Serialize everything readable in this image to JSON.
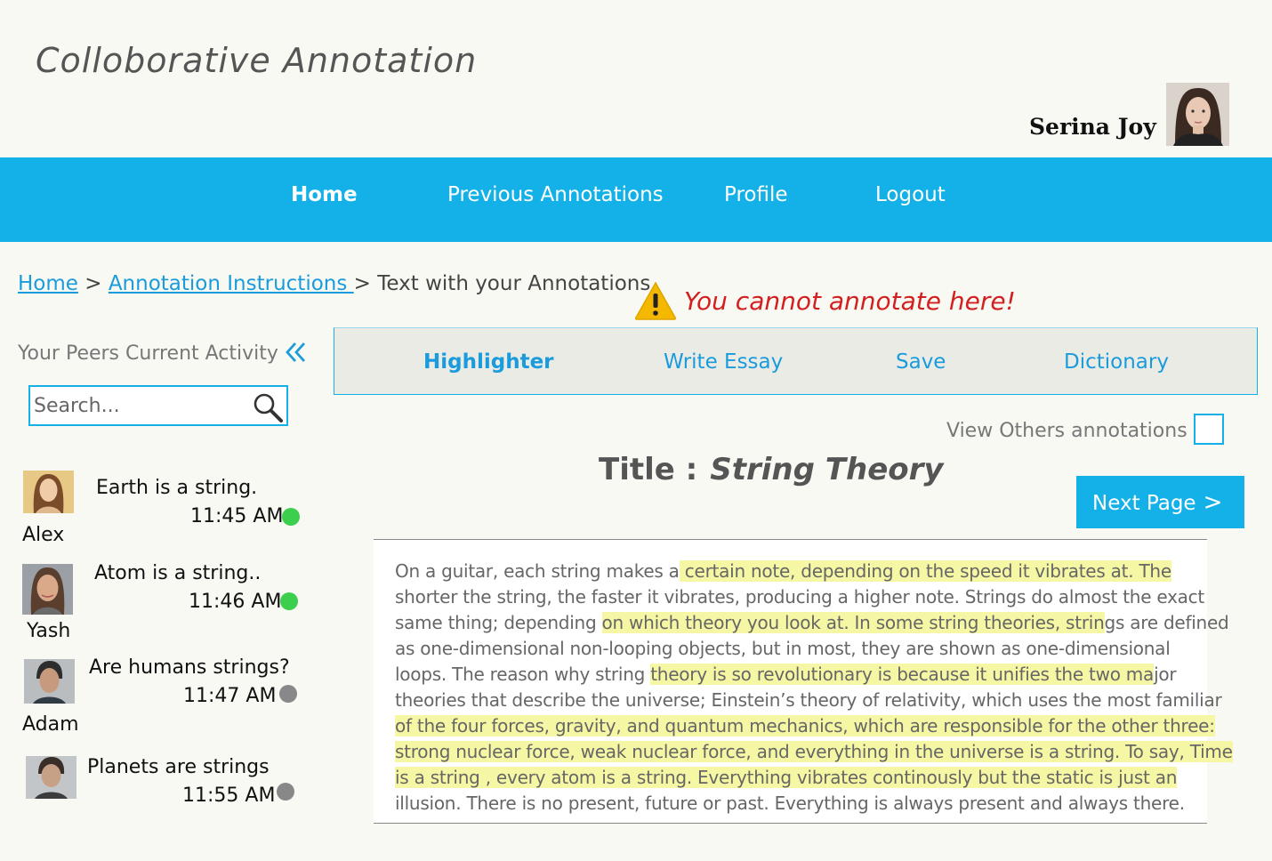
{
  "app": {
    "title": "Colloborative Annotation",
    "user_name": "Serina Joy"
  },
  "nav": {
    "items": [
      {
        "label": "Home",
        "active": true
      },
      {
        "label": "Previous Annotations"
      },
      {
        "label": "Profile"
      },
      {
        "label": "Logout"
      }
    ]
  },
  "breadcrumb": {
    "home": "Home",
    "sep1": ">",
    "instructions": " Annotation Instructions ",
    "sep2": ">",
    "current": "Text with your Annotations"
  },
  "warning": {
    "icon": "warning-icon",
    "text": "You cannot annotate here!"
  },
  "peers": {
    "title": "Your Peers Current Activity",
    "collapse_icon": "double-chevron-left-icon",
    "search_placeholder": "Search...",
    "items": [
      {
        "name": "Alex",
        "message": "Earth is a string.",
        "time": "11:45 AM",
        "status": "online",
        "status_color": "#3ccf4e"
      },
      {
        "name": "Yash",
        "message": "Atom is a string..",
        "time": "11:46 AM",
        "status": "online",
        "status_color": "#3ccf4e"
      },
      {
        "name": "Adam",
        "message": "Are humans strings?",
        "time": "11:47 AM",
        "status": "offline",
        "status_color": "#888888"
      },
      {
        "name": "",
        "message": "Planets are strings",
        "time": "11:55 AM",
        "status": "offline",
        "status_color": "#888888"
      }
    ]
  },
  "toolbar": {
    "items": [
      "Highlighter",
      "Write Essay",
      "Save",
      "Dictionary"
    ]
  },
  "view_others": {
    "label": "View Others annotations",
    "checked": false
  },
  "document": {
    "title_label": "Title :",
    "title": "String Theory",
    "next_label": "Next Page",
    "lines": [
      {
        "pre": "On a guitar, each string makes a",
        "hl": " certain note, depending on the speed it vibrates at. The  ",
        "post": ""
      },
      {
        "pre": "shorter the string, the faster it vibrates, producing a higher note. Strings do almost the exact",
        "hl": "",
        "post": ""
      },
      {
        "pre": "same thing; depending ",
        "hl": "on which theory you look at. In some string theories, strin",
        "post": "gs are defined"
      },
      {
        "pre": "as one-dimensional non-looping objects, but in most, they are shown as one-dimensional",
        "hl": "",
        "post": ""
      },
      {
        "pre": "loops. The reason why string ",
        "hl": "theory is so revolutionary is because it unifies the two ma",
        "post": "jor"
      },
      {
        "pre": "theories that describe the universe; Einstein’s theory of relativity, which uses the most familiar",
        "hl": "",
        "post": ""
      },
      {
        "pre": "",
        "hl": "of the four forces, gravity, and quantum mechanics, which are responsible for the other three:",
        "post": ""
      },
      {
        "pre": "",
        "hl": "strong nuclear force, weak nuclear force, and everything in the universe is a string. To say, Time",
        "post": ""
      },
      {
        "pre": "",
        "hl": "is a string , every atom is a string. Everything vibrates continously but the static is just an ",
        "post": ""
      },
      {
        "pre": "illusion. There is no present, future or past. Everything is always present and always there.",
        "hl": "",
        "post": ""
      }
    ]
  },
  "colors": {
    "accent": "#13b1e8",
    "link": "#1a9bdc",
    "highlight": "#f6f7a4",
    "warning_text": "#d21f1f",
    "background": "#f9f9f4"
  }
}
